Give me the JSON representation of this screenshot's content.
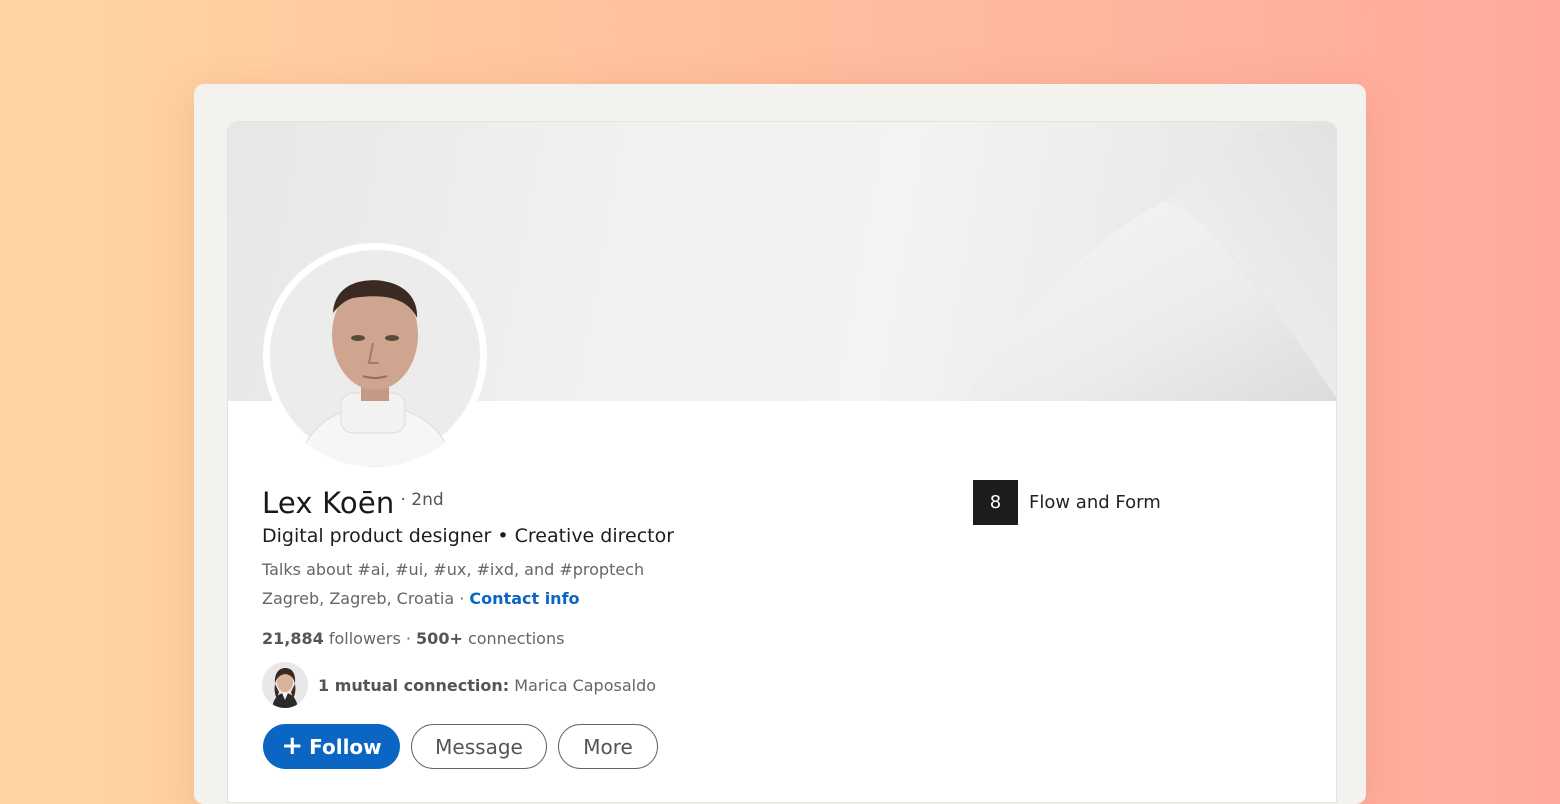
{
  "profile": {
    "name": "Lex Koēn",
    "degree": "· 2nd",
    "headline": "Digital product designer • Creative director",
    "talks_about": "Talks about #ai, #ui, #ux, #ixd, and #proptech",
    "location": "Zagreb, Zagreb, Croatia · ",
    "contact_link": "Contact info",
    "followers_count": "21,884",
    "followers_label": " followers ",
    "connections_sep": " · ",
    "connections_count": "500+",
    "connections_label": " connections",
    "mutual_count": "1 mutual connection:",
    "mutual_name": " Marica Caposaldo"
  },
  "company": {
    "logo_glyph": "8",
    "name": "Flow and Form"
  },
  "actions": {
    "follow_icon": "+",
    "follow_label": "Follow",
    "message_label": "Message",
    "more_label": "More"
  },
  "colors": {
    "accent": "#0a66c2",
    "background_start": "#ffd6a3",
    "background_end": "#ffaa9c"
  }
}
